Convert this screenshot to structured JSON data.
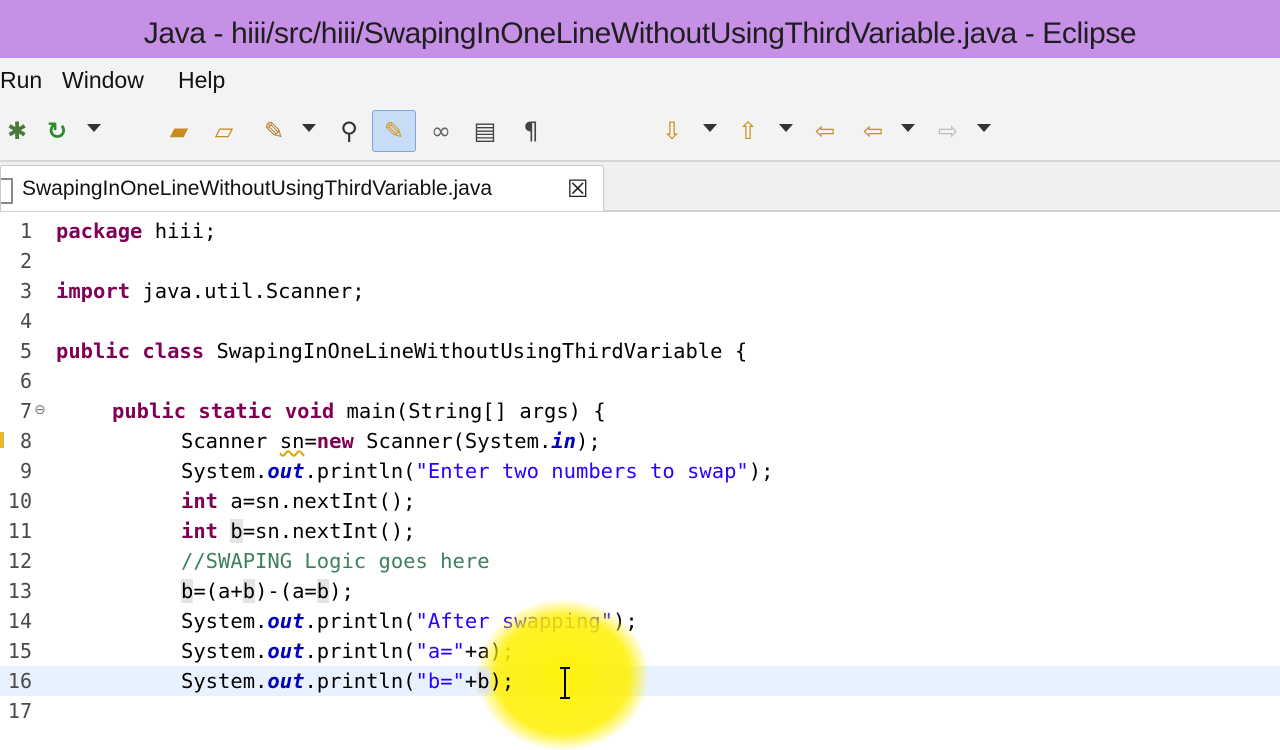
{
  "window": {
    "title": "Java - hiii/src/hiii/SwapingInOneLineWithoutUsingThirdVariable.java - Eclipse"
  },
  "menu": {
    "items": [
      "Run",
      "Window",
      "Help"
    ]
  },
  "toolbar": {
    "icons": [
      "debug-icon",
      "run-icon",
      "open-folder-icon",
      "open-folder-icon",
      "wand-icon",
      "type-hierarchy-icon",
      "mark-occurrences-icon",
      "toggle-icon",
      "block-selection-icon",
      "show-whitespace-icon",
      "next-annotation-icon",
      "prev-annotation-icon",
      "last-edit-icon",
      "back-icon",
      "forward-icon"
    ]
  },
  "editor": {
    "tab": {
      "label": "SwapingInOneLineWithoutUsingThirdVariable.java",
      "close_glyph": "☒"
    },
    "line_numbers": [
      "1",
      "2",
      "3",
      "4",
      "5",
      "6",
      "7",
      "8",
      "9",
      "10",
      "11",
      "12",
      "13",
      "14",
      "15",
      "16",
      "17"
    ],
    "code": {
      "l1_kw": "package",
      "l1_rest": " hiii;",
      "l3_kw": "import",
      "l3_rest": " java.util.Scanner;",
      "l5_kw1": "public",
      "l5_kw2": "class",
      "l5_rest": " SwapingInOneLineWithoutUsingThirdVariable {",
      "l7_kw1": "public",
      "l7_kw2": "static",
      "l7_kw3": "void",
      "l7_rest": " main(String[] args) {",
      "l8_a": "Scanner ",
      "l8_sn": "sn",
      "l8_eq": "=",
      "l8_kw": "new",
      "l8_b": " Scanner(System.",
      "l8_in": "in",
      "l8_c": ");",
      "l9_a": "System.",
      "l9_out": "out",
      "l9_b": ".println(",
      "l9_str": "\"Enter two numbers to swap\"",
      "l9_c": ");",
      "l10_kw": "int",
      "l10_rest": " a=sn.nextInt();",
      "l11_kw": "int",
      "l11_sp": " ",
      "l11_b": "b",
      "l11_rest": "=sn.nextInt();",
      "l12_cm": "//SWAPING Logic goes here",
      "l13_b1": "b",
      "l13_a": "=(a+",
      "l13_b2": "b",
      "l13_c": ")-(a=",
      "l13_b3": "b",
      "l13_d": ");",
      "l14_a": "System.",
      "l14_out": "out",
      "l14_b": ".println(",
      "l14_str": "\"After swapping\"",
      "l14_c": ");",
      "l15_a": "System.",
      "l15_out": "out",
      "l15_b": ".println(",
      "l15_str": "\"a=\"",
      "l15_c": "+a);",
      "l16_a": "System.",
      "l16_out": "out",
      "l16_b": ".println(",
      "l16_str": "\"b=\"",
      "l16_c": "+",
      "l16_bvar": "b",
      "l16_d": ");"
    }
  },
  "colors": {
    "title_bar": "#c590e6",
    "keyword": "#7f0055",
    "string": "#2a00ff",
    "comment": "#3f7f5f",
    "field": "#0000c0",
    "current_line": "#e8f2fe",
    "cursor_highlight": "#fff200"
  }
}
